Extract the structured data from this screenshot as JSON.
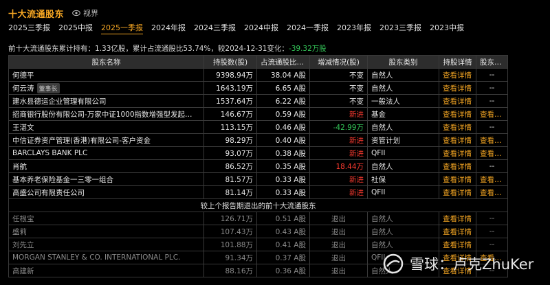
{
  "header": {
    "title": "十大流通股东",
    "view_label": "视界"
  },
  "tabs": [
    {
      "label": "2025三季报",
      "active": false
    },
    {
      "label": "2025中报",
      "active": false
    },
    {
      "label": "2025一季报",
      "active": true
    },
    {
      "label": "2024年报",
      "active": false
    },
    {
      "label": "2024三季报",
      "active": false
    },
    {
      "label": "2024中报",
      "active": false
    },
    {
      "label": "2024一季报",
      "active": false
    },
    {
      "label": "2023年报",
      "active": false
    },
    {
      "label": "2023三季报",
      "active": false
    },
    {
      "label": "2023中报",
      "active": false
    }
  ],
  "summary": {
    "text": "前十大流通股东累计持有：1.33亿股，累计占流通股比53.74%，较2024-12-31变化：",
    "change": "-39.32万股"
  },
  "table": {
    "columns": [
      "股东名称",
      "持股数(股)",
      "占流通股比(%)",
      "增减情况(股)",
      "股东类别",
      "持股详情",
      "股东进出"
    ],
    "rows": [
      {
        "name": "何德平",
        "badge": "",
        "shares": "9398.94万",
        "ratio": "38.04 A股",
        "change": "不变",
        "change_color": "white",
        "type": "自然人",
        "detail": "查看详情",
        "flow": "--"
      },
      {
        "name": "何云涛",
        "badge": "董事长",
        "shares": "1643.19万",
        "ratio": "6.65 A股",
        "change": "不变",
        "change_color": "white",
        "type": "自然人",
        "detail": "查看详情",
        "flow": "--"
      },
      {
        "name": "建水县德运企业管理有限公司",
        "badge": "",
        "shares": "1537.64万",
        "ratio": "6.22 A股",
        "change": "不变",
        "change_color": "white",
        "type": "一般法人",
        "detail": "查看详情",
        "flow": "--"
      },
      {
        "name": "招商银行股份有限公司-万家中证1000指数增强型发起…",
        "badge": "",
        "shares": "146.67万",
        "ratio": "0.59 A股",
        "change": "新进",
        "change_color": "red",
        "type": "基金",
        "detail": "查看详情",
        "flow": "查看详情"
      },
      {
        "name": "王湛文",
        "badge": "",
        "shares": "113.15万",
        "ratio": "0.46 A股",
        "change": "-42.99万",
        "change_color": "green",
        "type": "自然人",
        "detail": "查看详情",
        "flow": "--"
      },
      {
        "name": "中信证券资产管理(香港)有限公司-客户资金",
        "badge": "",
        "shares": "98.29万",
        "ratio": "0.40 A股",
        "change": "新进",
        "change_color": "red",
        "type": "资管计划",
        "detail": "查看详情",
        "flow": "查看详情"
      },
      {
        "name": "BARCLAYS BANK PLC",
        "badge": "",
        "shares": "93.07万",
        "ratio": "0.38 A股",
        "change": "新进",
        "change_color": "red",
        "type": "QFII",
        "detail": "查看详情",
        "flow": "查看详情"
      },
      {
        "name": "肖航",
        "badge": "",
        "shares": "86.52万",
        "ratio": "0.35 A股",
        "change": "18.44万",
        "change_color": "red",
        "type": "自然人",
        "detail": "查看详情",
        "flow": "--"
      },
      {
        "name": "基本养老保险基金一三零一组合",
        "badge": "",
        "shares": "81.57万",
        "ratio": "0.33 A股",
        "change": "新进",
        "change_color": "red",
        "type": "社保",
        "detail": "查看详情",
        "flow": "查看详情"
      },
      {
        "name": "高盛公司有限责任公司",
        "badge": "",
        "shares": "81.14万",
        "ratio": "0.33 A股",
        "change": "新进",
        "change_color": "red",
        "type": "QFII",
        "detail": "查看详情",
        "flow": "查看详情"
      }
    ],
    "section_label": "较上个报告期退出的前十大流通股东",
    "exited_rows": [
      {
        "name": "任根宝",
        "shares": "126.71万",
        "ratio": "0.51 A股",
        "change": "退出",
        "type": "自然人",
        "detail": "查看详情",
        "flow": "--"
      },
      {
        "name": "盛莉",
        "shares": "107.43万",
        "ratio": "0.43 A股",
        "change": "退出",
        "type": "自然人",
        "detail": "查看详情",
        "flow": "--"
      },
      {
        "name": "刘先立",
        "shares": "101.88万",
        "ratio": "0.41 A股",
        "change": "退出",
        "type": "自然人",
        "detail": "查看详情",
        "flow": "--"
      },
      {
        "name": "MORGAN STANLEY & CO. INTERNATIONAL PLC.",
        "shares": "91.34万",
        "ratio": "0.37 A股",
        "change": "退出",
        "type": "QFII",
        "detail": "查看详情",
        "flow": "查看详情"
      },
      {
        "name": "高建新",
        "shares": "88.16万",
        "ratio": "0.36 A股",
        "change": "退出",
        "type": "自然人",
        "detail": "查看详情",
        "flow": "--"
      }
    ]
  },
  "watermark": {
    "text": "雪球：卢克ZhuKer"
  }
}
